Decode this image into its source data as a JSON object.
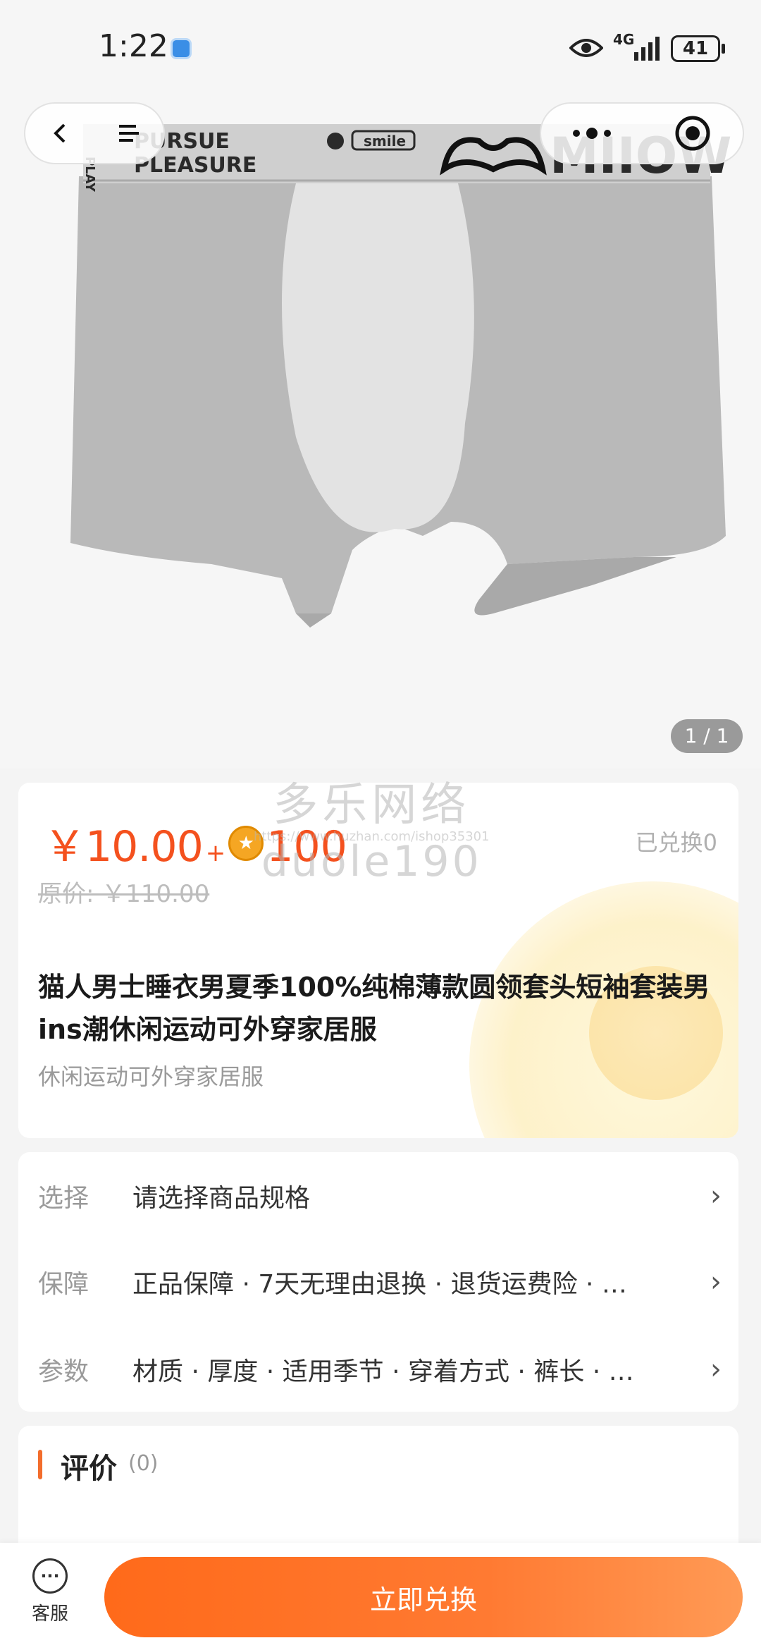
{
  "status_bar": {
    "time": "1:22",
    "network": "4G",
    "battery": "41"
  },
  "hero": {
    "page_indicator": "1 / 1",
    "product_print": [
      "PURSUE",
      "PLEASURE",
      "smile",
      "MIIOW",
      "PLAY"
    ]
  },
  "product": {
    "price": "￥10.00",
    "plus": "+",
    "points": "100",
    "redeemed": "已兑换0",
    "original_price": "原价: ￥110.00",
    "title": "猫人男士睡衣男夏季100%纯棉薄款圆领套头短袖套装男ins潮休闲运动可外穿家居服",
    "subtitle": "休闲运动可外穿家居服"
  },
  "watermark": {
    "line1": "多乐网络",
    "line2": "https://www.huzhan.com/ishop35301",
    "line3": "duole190"
  },
  "options": [
    {
      "label": "选择",
      "value": "请选择商品规格"
    },
    {
      "label": "保障",
      "value": "正品保障 · 7天无理由退换 · 退货运费险 · …"
    },
    {
      "label": "参数",
      "value": "材质 · 厚度 · 适用季节 · 穿着方式 · 裤长 · …"
    }
  ],
  "reviews": {
    "title": "评价",
    "count": "(0)"
  },
  "bottom": {
    "service_label": "客服",
    "cta_label": "立即兑换"
  },
  "colors": {
    "accent": "#f4511e",
    "cta_start": "#ff6a1a",
    "cta_end": "#ff9a55",
    "product_gray": "#b9b9b9"
  },
  "icons": [
    "back-icon",
    "menu-icon",
    "more-icon",
    "capsule-icon",
    "coin-icon",
    "chat-icon",
    "chevron-right-icon"
  ]
}
